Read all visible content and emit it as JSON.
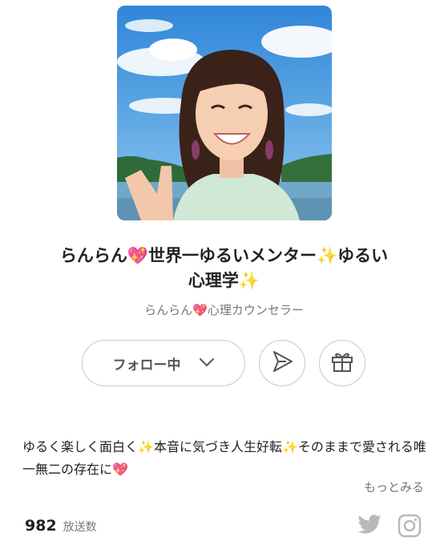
{
  "profile": {
    "title_part1": "らんらん",
    "title_part2": "世界一ゆるいメンター",
    "title_part3": "ゆるい",
    "title_part4": "心理学",
    "subtitle_name": "らんらん",
    "subtitle_role": "心理カウンセラー"
  },
  "actions": {
    "follow_label": "フォロー中",
    "share_icon": "send-icon",
    "gift_icon": "gift-icon"
  },
  "description": {
    "part1": "ゆるく楽しく面白く",
    "part2": "本音に気づき人生好転",
    "part3": "そのままで愛される唯一無二の存在に",
    "more_label": "もっとみる"
  },
  "stats": {
    "broadcast_count": "982",
    "broadcast_label": "放送数"
  },
  "social": {
    "twitter_icon": "twitter-icon",
    "instagram_icon": "instagram-icon"
  },
  "colors": {
    "heart": "#e53c8f",
    "sparkle": "#f2c21b",
    "border": "#c9c9c9",
    "muted": "#777777"
  }
}
